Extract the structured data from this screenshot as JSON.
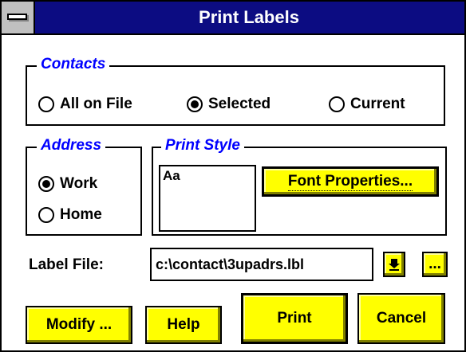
{
  "window": {
    "title": "Print Labels"
  },
  "contacts": {
    "label": "Contacts",
    "options": [
      {
        "label": "All on File",
        "selected": false
      },
      {
        "label": "Selected",
        "selected": true
      },
      {
        "label": "Current",
        "selected": false
      }
    ]
  },
  "address": {
    "label": "Address",
    "options": [
      {
        "label": "Work",
        "selected": true
      },
      {
        "label": "Home",
        "selected": false
      }
    ]
  },
  "print_style": {
    "label": "Print Style",
    "preview_text": "Aa",
    "font_button": "Font Properties..."
  },
  "label_file": {
    "label": "Label File:",
    "value": "c:\\contact\\3upadrs.lbl",
    "browse_button": "..."
  },
  "buttons": {
    "modify": "Modify ...",
    "help": "Help",
    "print": "Print",
    "cancel": "Cancel"
  },
  "colors": {
    "title_bar": "#0c0c82",
    "button_face": "#ffff00",
    "group_label": "#0000ff"
  }
}
